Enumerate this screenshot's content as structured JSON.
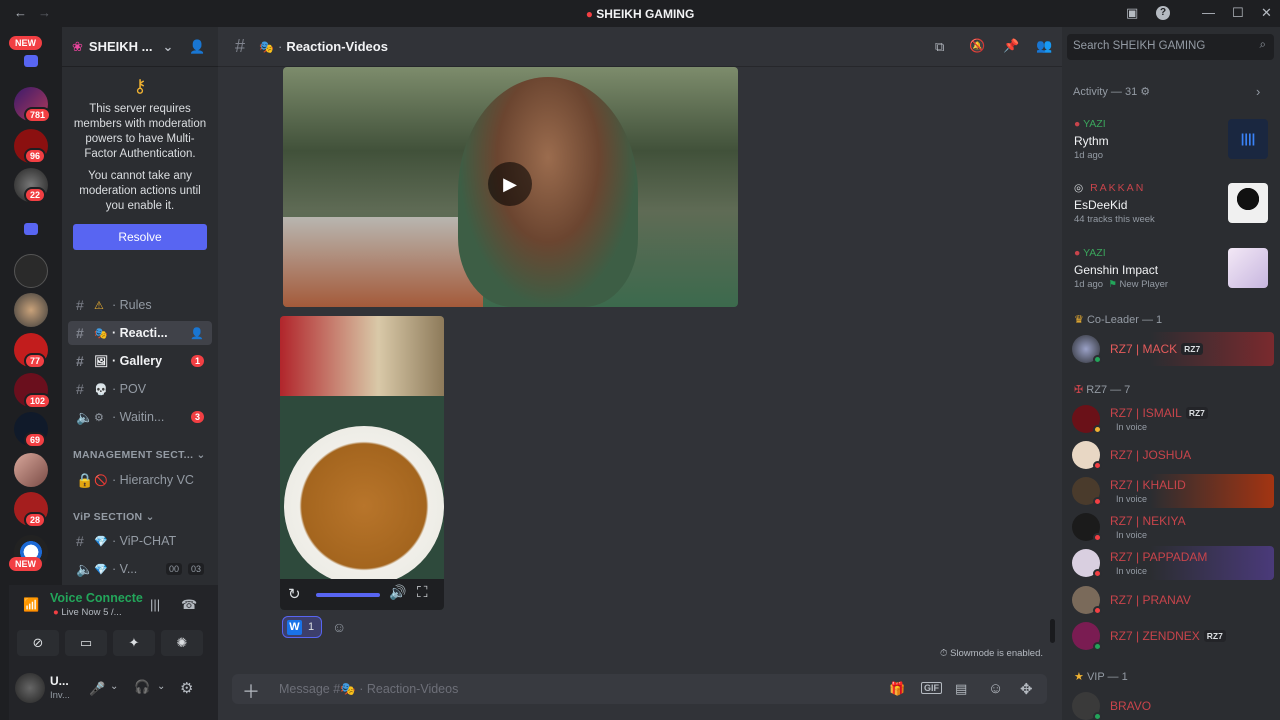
{
  "window": {
    "title": "SHEIKH GAMING"
  },
  "rail": {
    "new_top": "NEW",
    "new_bottom": "NEW",
    "badges": [
      "781",
      "96",
      "22",
      "77",
      "102",
      "69",
      "28"
    ]
  },
  "guild": {
    "name": "SHEIKH ..."
  },
  "mfa": {
    "line1": "This server requires members with moderation powers to have Multi-Factor Authentication.",
    "line2": "You cannot take any moderation actions until you enable it.",
    "button": "Resolve"
  },
  "channels": [
    {
      "emoji": "⚠",
      "name": "Rules",
      "mention": ""
    },
    {
      "emoji": "🎭",
      "name": "Reacti...",
      "mention": ""
    },
    {
      "emoji": "🖼",
      "name": "Gallery",
      "mention": "1"
    },
    {
      "emoji": "💀",
      "name": "POV",
      "mention": ""
    },
    {
      "emoji": "⚙",
      "name": "Waitin...",
      "mention": "3"
    }
  ],
  "categories": {
    "management": "MANAGEMENT SECT...",
    "vip": "ViP SECTION"
  },
  "management_channels": [
    {
      "emoji": "🚫",
      "name": "Hierarchy VC"
    }
  ],
  "vip_channels": [
    {
      "emoji": "💎",
      "name": "ViP-CHAT"
    },
    {
      "emoji": "💎",
      "name": "V...",
      "count1": "00",
      "count2": "03"
    }
  ],
  "voice": {
    "status": "Voice Connecte",
    "sub": "Live Now 5 /..."
  },
  "user": {
    "name": "U...",
    "sub": "Inv..."
  },
  "chat": {
    "channel_emoji": "🎭",
    "channel_name": "Reaction-Videos",
    "reaction_count": "1",
    "slowmode": "Slowmode is enabled.",
    "input_placeholder_prefix": "Message #",
    "input_placeholder_channel": "Reaction-Videos"
  },
  "members": {
    "search_placeholder": "Search SHEIKH GAMING",
    "activity_header": "Activity — 31",
    "activities": [
      {
        "user": "YAZI",
        "title": "Rythm",
        "sub": "1d ago"
      },
      {
        "user": "RAKKAN",
        "title": "EsDeeKid",
        "sub": "44 tracks this week"
      },
      {
        "user": "YAZI",
        "title": "Genshin Impact",
        "sub": "1d ago",
        "sub2": "New Player"
      }
    ],
    "coleader_header": "Co-Leader — 1",
    "coleaders": [
      {
        "name": "RZ7 | MACK",
        "tag": "RZ7"
      }
    ],
    "rz7_header": "RZ7 — 7",
    "rz7": [
      {
        "name": "RZ7 | ISMAIL",
        "tag": "RZ7",
        "sub": "In voice"
      },
      {
        "name": "RZ7 | JOSHUA",
        "tag": "",
        "sub": ""
      },
      {
        "name": "RZ7 | KHALID",
        "tag": "",
        "sub": "In voice"
      },
      {
        "name": "RZ7 | NEKIYA",
        "tag": "",
        "sub": "In voice"
      },
      {
        "name": "RZ7 | PAPPADAM",
        "tag": "",
        "sub": "In voice"
      },
      {
        "name": "RZ7 | PRANAV",
        "tag": "",
        "sub": ""
      },
      {
        "name": "RZ7 | ZENDNEX",
        "tag": "RZ7",
        "sub": ""
      }
    ],
    "vip_header": "VIP — 1",
    "vip": [
      {
        "name": "BRAVO"
      }
    ]
  },
  "colors": {
    "accent": "#5865f2",
    "mention": "#f23f43",
    "member_red": "#c8444b",
    "online": "#23a55a"
  }
}
